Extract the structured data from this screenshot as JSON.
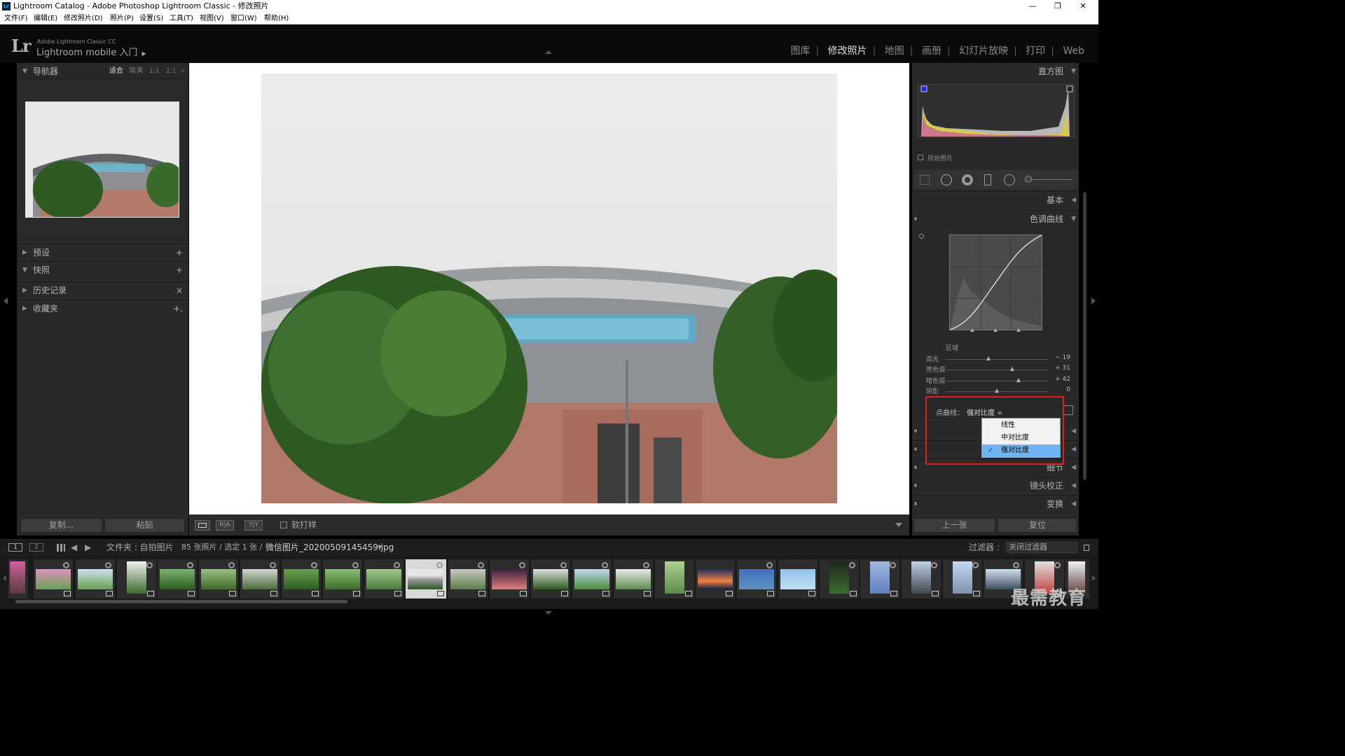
{
  "window": {
    "title": "Lightroom Catalog - Adobe Photoshop Lightroom Classic - 修改照片",
    "app_icon": "Lr",
    "minimize": "—",
    "maximize": "❐",
    "close": "✕"
  },
  "menu": [
    "文件(F)",
    "编辑(E)",
    "修改照片(D)",
    "照片(P)",
    "设置(S)",
    "工具(T)",
    "视图(V)",
    "窗口(W)",
    "帮助(H)"
  ],
  "identity": {
    "logo": "Lr",
    "product": "Adobe Lightroom Classic CC",
    "mobile": "Lightroom mobile 入门",
    "arrow": "▶"
  },
  "modules": [
    "图库",
    "修改照片",
    "地图",
    "画册",
    "幻灯片放映",
    "打印",
    "Web"
  ],
  "active_module": "修改照片",
  "navigator": {
    "title": "导航器",
    "zoom": [
      "适合",
      "填满",
      "1:1",
      "2:1"
    ],
    "zoom_more": "÷"
  },
  "left_panels": [
    {
      "label": "预设",
      "action": "+"
    },
    {
      "label": "快照",
      "action": "+"
    },
    {
      "label": "历史记录",
      "action": "×"
    },
    {
      "label": "收藏夹",
      "action": "+."
    }
  ],
  "left_buttons": {
    "copy": "复制...",
    "paste": "粘贴"
  },
  "toolbar": {
    "view_ra": "R|A",
    "view_yy": "Y|Y",
    "soft_proof": "软打样"
  },
  "right_panel": {
    "histogram": "直方图",
    "original_photo": "原始照片",
    "basic": "基本",
    "tone_curve": "色调曲线",
    "region": "区域",
    "sliders": [
      {
        "name": "高光",
        "value": "− 19",
        "level": 0.42
      },
      {
        "name": "亮色调",
        "value": "+ 31",
        "level": 0.65
      },
      {
        "name": "暗色调",
        "value": "+ 42",
        "level": 0.71
      },
      {
        "name": "阴影",
        "value": "0",
        "level": 0.5
      }
    ],
    "point_curve_label": "点曲线：",
    "point_curve_value": "强对比度 ÷",
    "detail": "细节",
    "lens": "镜头校正",
    "transform": "变换",
    "prev": "上一张",
    "reset": "复位"
  },
  "dropdown": {
    "options": [
      "线性",
      "中对比度",
      "强对比度"
    ],
    "selected": "强对比度",
    "checkmark": "✓"
  },
  "filmstrip_bar": {
    "monitor1": "1",
    "monitor2": "2",
    "source": "文件夹 : 自拍图片",
    "count": "85 张照片 / 选定 1 张 /",
    "filename": "微信图片_20200509145459.jpg",
    "filter_label": "过滤器 :",
    "filter_value": "关闭过滤器"
  },
  "watermark": "最需教育"
}
